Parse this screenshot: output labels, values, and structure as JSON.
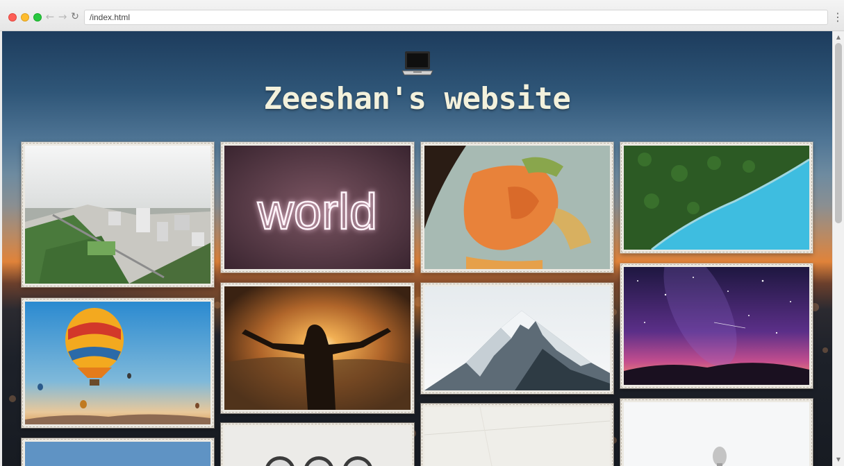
{
  "browser": {
    "url": "/index.html",
    "back_icon": "arrow-left-icon",
    "forward_icon": "arrow-right-icon",
    "reload_icon": "reload-icon",
    "menu_icon": "vertical-dots-icon"
  },
  "site": {
    "logo_icon": "laptop-emoji-icon",
    "title": "Zeeshan's website"
  },
  "gallery": {
    "photos": [
      {
        "id": "city-aerial",
        "subject": "aerial city with park"
      },
      {
        "id": "world-neon",
        "subject": "neon sign",
        "sign_text": "world"
      },
      {
        "id": "globe-europe",
        "subject": "globe showing Europe"
      },
      {
        "id": "forest-lake",
        "subject": "aerial forest and turquoise water"
      },
      {
        "id": "hot-air-balloons",
        "subject": "hot air balloons at sunrise"
      },
      {
        "id": "man-sunset",
        "subject": "man with open arms at sunset"
      },
      {
        "id": "snowy-mountain",
        "subject": "snowy mountain peak"
      },
      {
        "id": "milky-way",
        "subject": "purple starry night sky"
      },
      {
        "id": "sky-blue-partial",
        "subject": "sky"
      },
      {
        "id": "clocks",
        "subject": "clocks on wall"
      },
      {
        "id": "white-wall",
        "subject": "white wall"
      },
      {
        "id": "telescope",
        "subject": "coin-operated binoculars"
      }
    ]
  },
  "colors": {
    "title": "#f3f1dc",
    "frame": "#ece9e2",
    "sky_top": "#1d3c5d",
    "horizon_glow": "#e0833a"
  }
}
